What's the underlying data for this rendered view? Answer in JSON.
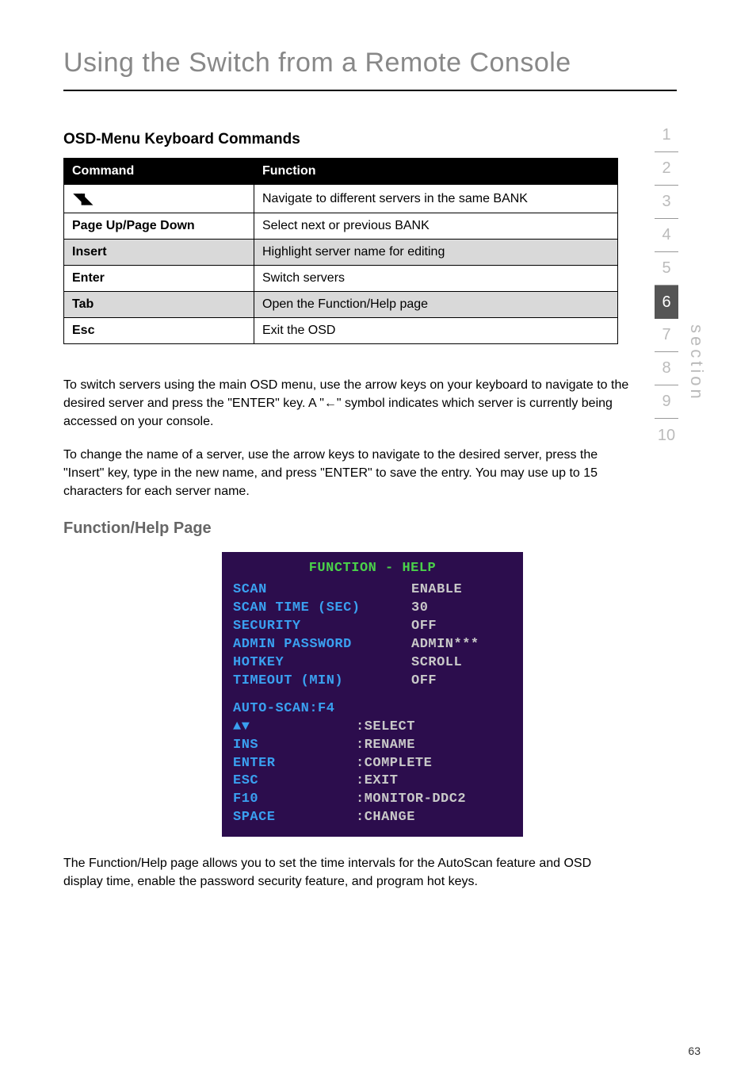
{
  "page_title": "Using the Switch from a Remote Console",
  "section_heading": "OSD-Menu Keyboard Commands",
  "table": {
    "headers": {
      "command": "Command",
      "function": "Function"
    },
    "rows": [
      {
        "command_icon": "arrow-updown-icon",
        "function": "Navigate to different servers in the same BANK",
        "shaded": false
      },
      {
        "command": "Page Up/Page Down",
        "function": "Select next or previous BANK",
        "shaded": false
      },
      {
        "command": "Insert",
        "function": "Highlight server name for editing",
        "shaded": true
      },
      {
        "command": "Enter",
        "function": "Switch servers",
        "shaded": false
      },
      {
        "command": "Tab",
        "function": "Open the Function/Help page",
        "shaded": true
      },
      {
        "command": "Esc",
        "function": "Exit the OSD",
        "shaded": false
      }
    ]
  },
  "body": {
    "para1": "To switch servers using the main OSD menu, use the arrow keys on your keyboard to navigate to the desired server and press the \"ENTER\" key. A \"←\" symbol indicates which server is currently being accessed on your console.",
    "para2": "To change the name of a server, use the arrow keys to navigate to the desired server, press the \"Insert\" key, type in the new name, and press \"ENTER\" to save the entry. You may use up to 15 characters for each server name.",
    "para3": "The Function/Help page allows you to set the time intervals for the AutoScan feature and OSD display time, enable the password security feature, and program hot keys."
  },
  "subheading": "Function/Help Page",
  "osd": {
    "title": "FUNCTION - HELP",
    "settings": [
      {
        "label": "SCAN",
        "value": "ENABLE"
      },
      {
        "label": "SCAN TIME (SEC)",
        "value": "30"
      },
      {
        "label": "SECURITY",
        "value": "OFF"
      },
      {
        "label": "ADMIN PASSWORD",
        "value": "ADMIN***"
      },
      {
        "label": "HOTKEY",
        "value": "SCROLL"
      },
      {
        "label": "TIMEOUT (MIN)",
        "value": "OFF"
      }
    ],
    "autoscan_line": "AUTO-SCAN:F4",
    "help": [
      {
        "key": "▲▼",
        "action": ":SELECT"
      },
      {
        "key": "INS",
        "action": ":RENAME"
      },
      {
        "key": "ENTER",
        "action": ":COMPLETE"
      },
      {
        "key": "ESC",
        "action": ":EXIT"
      },
      {
        "key": "F10",
        "action": ":MONITOR-DDC2"
      },
      {
        "key": "SPACE",
        "action": ":CHANGE"
      }
    ]
  },
  "sidenav": {
    "items": [
      "1",
      "2",
      "3",
      "4",
      "5",
      "6",
      "7",
      "8",
      "9",
      "10"
    ],
    "active": "6",
    "label": "section"
  },
  "page_number": "63"
}
